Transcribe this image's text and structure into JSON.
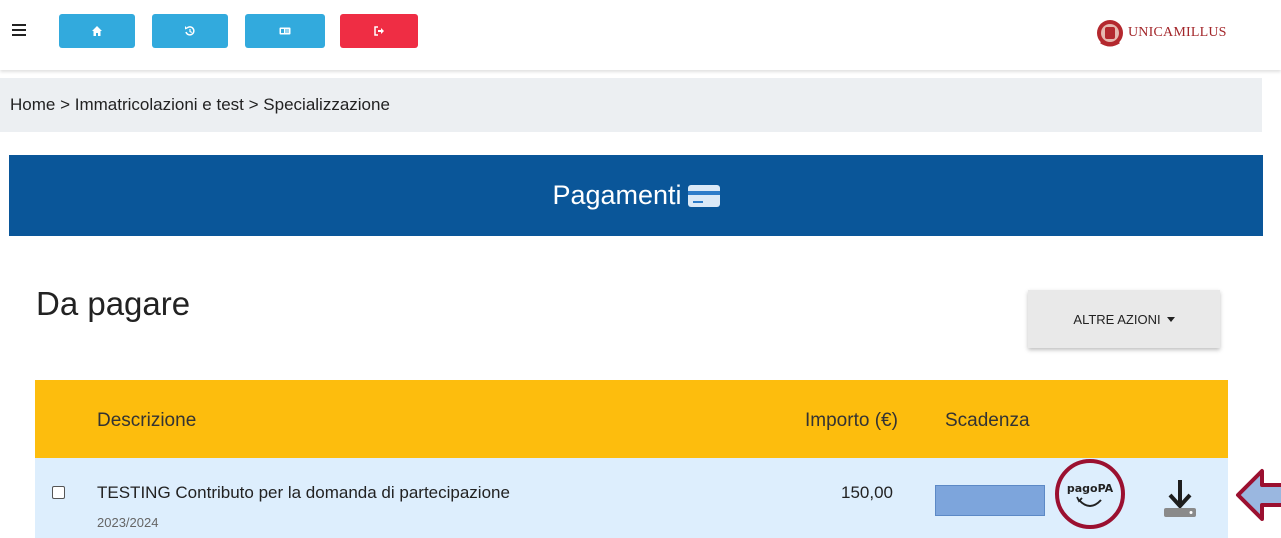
{
  "header": {
    "logo_text": "UNICAMILLUS",
    "buttons": [
      {
        "name": "home",
        "color": "#32aadd"
      },
      {
        "name": "history",
        "color": "#32aadd"
      },
      {
        "name": "id-card",
        "color": "#32aadd"
      },
      {
        "name": "logout",
        "color": "#ef2d44"
      }
    ]
  },
  "breadcrumb": {
    "items": [
      "Home",
      "Immatricolazioni e test",
      "Specializzazione"
    ],
    "separator": ">"
  },
  "banner": {
    "title": "Pagamenti",
    "icon": "credit-card-icon",
    "color": "#0a5699"
  },
  "section": {
    "title": "Da pagare",
    "actions_label": "ALTRE AZIONI"
  },
  "table": {
    "header_color": "#fdbd0d",
    "row_color": "#ddeefd",
    "columns": [
      "Descrizione",
      "Importo (€)",
      "Scadenza"
    ],
    "rows": [
      {
        "tag": "TESTING",
        "description": "Contributo per la domanda di partecipazione",
        "year": "2023/2024",
        "amount": "150,00",
        "pagopa_label": "pagoPA"
      }
    ]
  },
  "annotation": {
    "circle_color": "#9b1030",
    "arrow_color": "#9b1030"
  }
}
